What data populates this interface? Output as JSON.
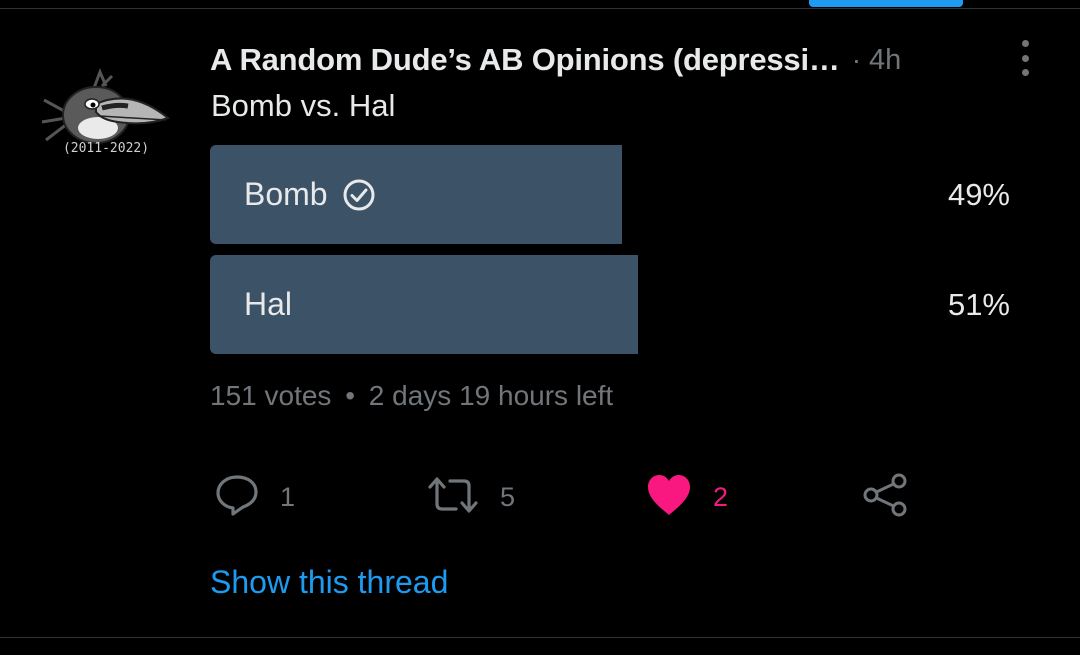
{
  "tweet": {
    "author_name": "A Random Dude’s AB Opinions (depressi…",
    "separator": "·",
    "time_ago": "4h",
    "text": "Bomb vs. Hal",
    "avatar_caption": "(2011-2022)"
  },
  "poll": {
    "options": [
      {
        "label": "Bomb",
        "percent_text": "49%",
        "percent": 49,
        "selected": true
      },
      {
        "label": "Hal",
        "percent_text": "51%",
        "percent": 51,
        "selected": false
      }
    ],
    "votes": "151 votes",
    "meta_separator": "•",
    "time_left": "2 days 19 hours left"
  },
  "actions": {
    "reply_count": "1",
    "retweet_count": "5",
    "like_count": "2",
    "liked": true
  },
  "show_thread_label": "Show this thread",
  "colors": {
    "accent_blue": "#1d9bf0",
    "like_pink": "#f91880",
    "poll_bar": "#3c5266",
    "muted": "#71767b"
  }
}
